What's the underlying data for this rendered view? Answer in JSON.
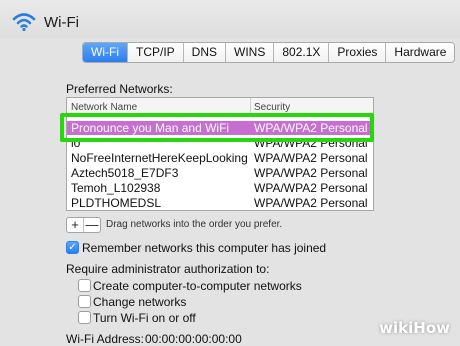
{
  "window": {
    "title": "Wi-Fi",
    "icon": "wifi-icon"
  },
  "tabs": [
    {
      "label": "Wi-Fi",
      "active": true
    },
    {
      "label": "TCP/IP"
    },
    {
      "label": "DNS"
    },
    {
      "label": "WINS"
    },
    {
      "label": "802.1X"
    },
    {
      "label": "Proxies"
    },
    {
      "label": "Hardware"
    }
  ],
  "preferred": {
    "heading": "Preferred Networks:",
    "columns": [
      "Network Name",
      "Security"
    ],
    "rows": [
      {
        "name": "Pronounce you Man and WiFi",
        "security": "WPA/WPA2 Personal",
        "selected": true
      },
      {
        "name": "io",
        "security": "WPA/WPA2 Personal"
      },
      {
        "name": "NoFreeInternetHereKeepLooking",
        "security": "WPA/WPA2 Personal"
      },
      {
        "name": "Aztech5018_E7DF3",
        "security": "WPA/WPA2 Personal"
      },
      {
        "name": "Temoh_L102938",
        "security": "WPA/WPA2 Personal"
      },
      {
        "name": "PLDTHOMEDSL",
        "security": "WPA/WPA2 Personal"
      }
    ],
    "add_label": "+",
    "remove_label": "—",
    "drag_hint": "Drag networks into the order you prefer."
  },
  "remember": {
    "label": "Remember networks this computer has joined",
    "checked": true
  },
  "admin": {
    "heading": "Require administrator authorization to:",
    "options": [
      {
        "label": "Create computer-to-computer networks",
        "checked": false
      },
      {
        "label": "Change networks",
        "checked": false
      },
      {
        "label": "Turn Wi-Fi on or off",
        "checked": false
      }
    ]
  },
  "address": {
    "label": "Wi-Fi Address:",
    "value": "00:00:00:00:00:00"
  },
  "watermark": "wikiHow",
  "colors": {
    "selection": "#c76fd0",
    "highlight_border": "#27d60c",
    "accent": "#2b7ef0"
  }
}
